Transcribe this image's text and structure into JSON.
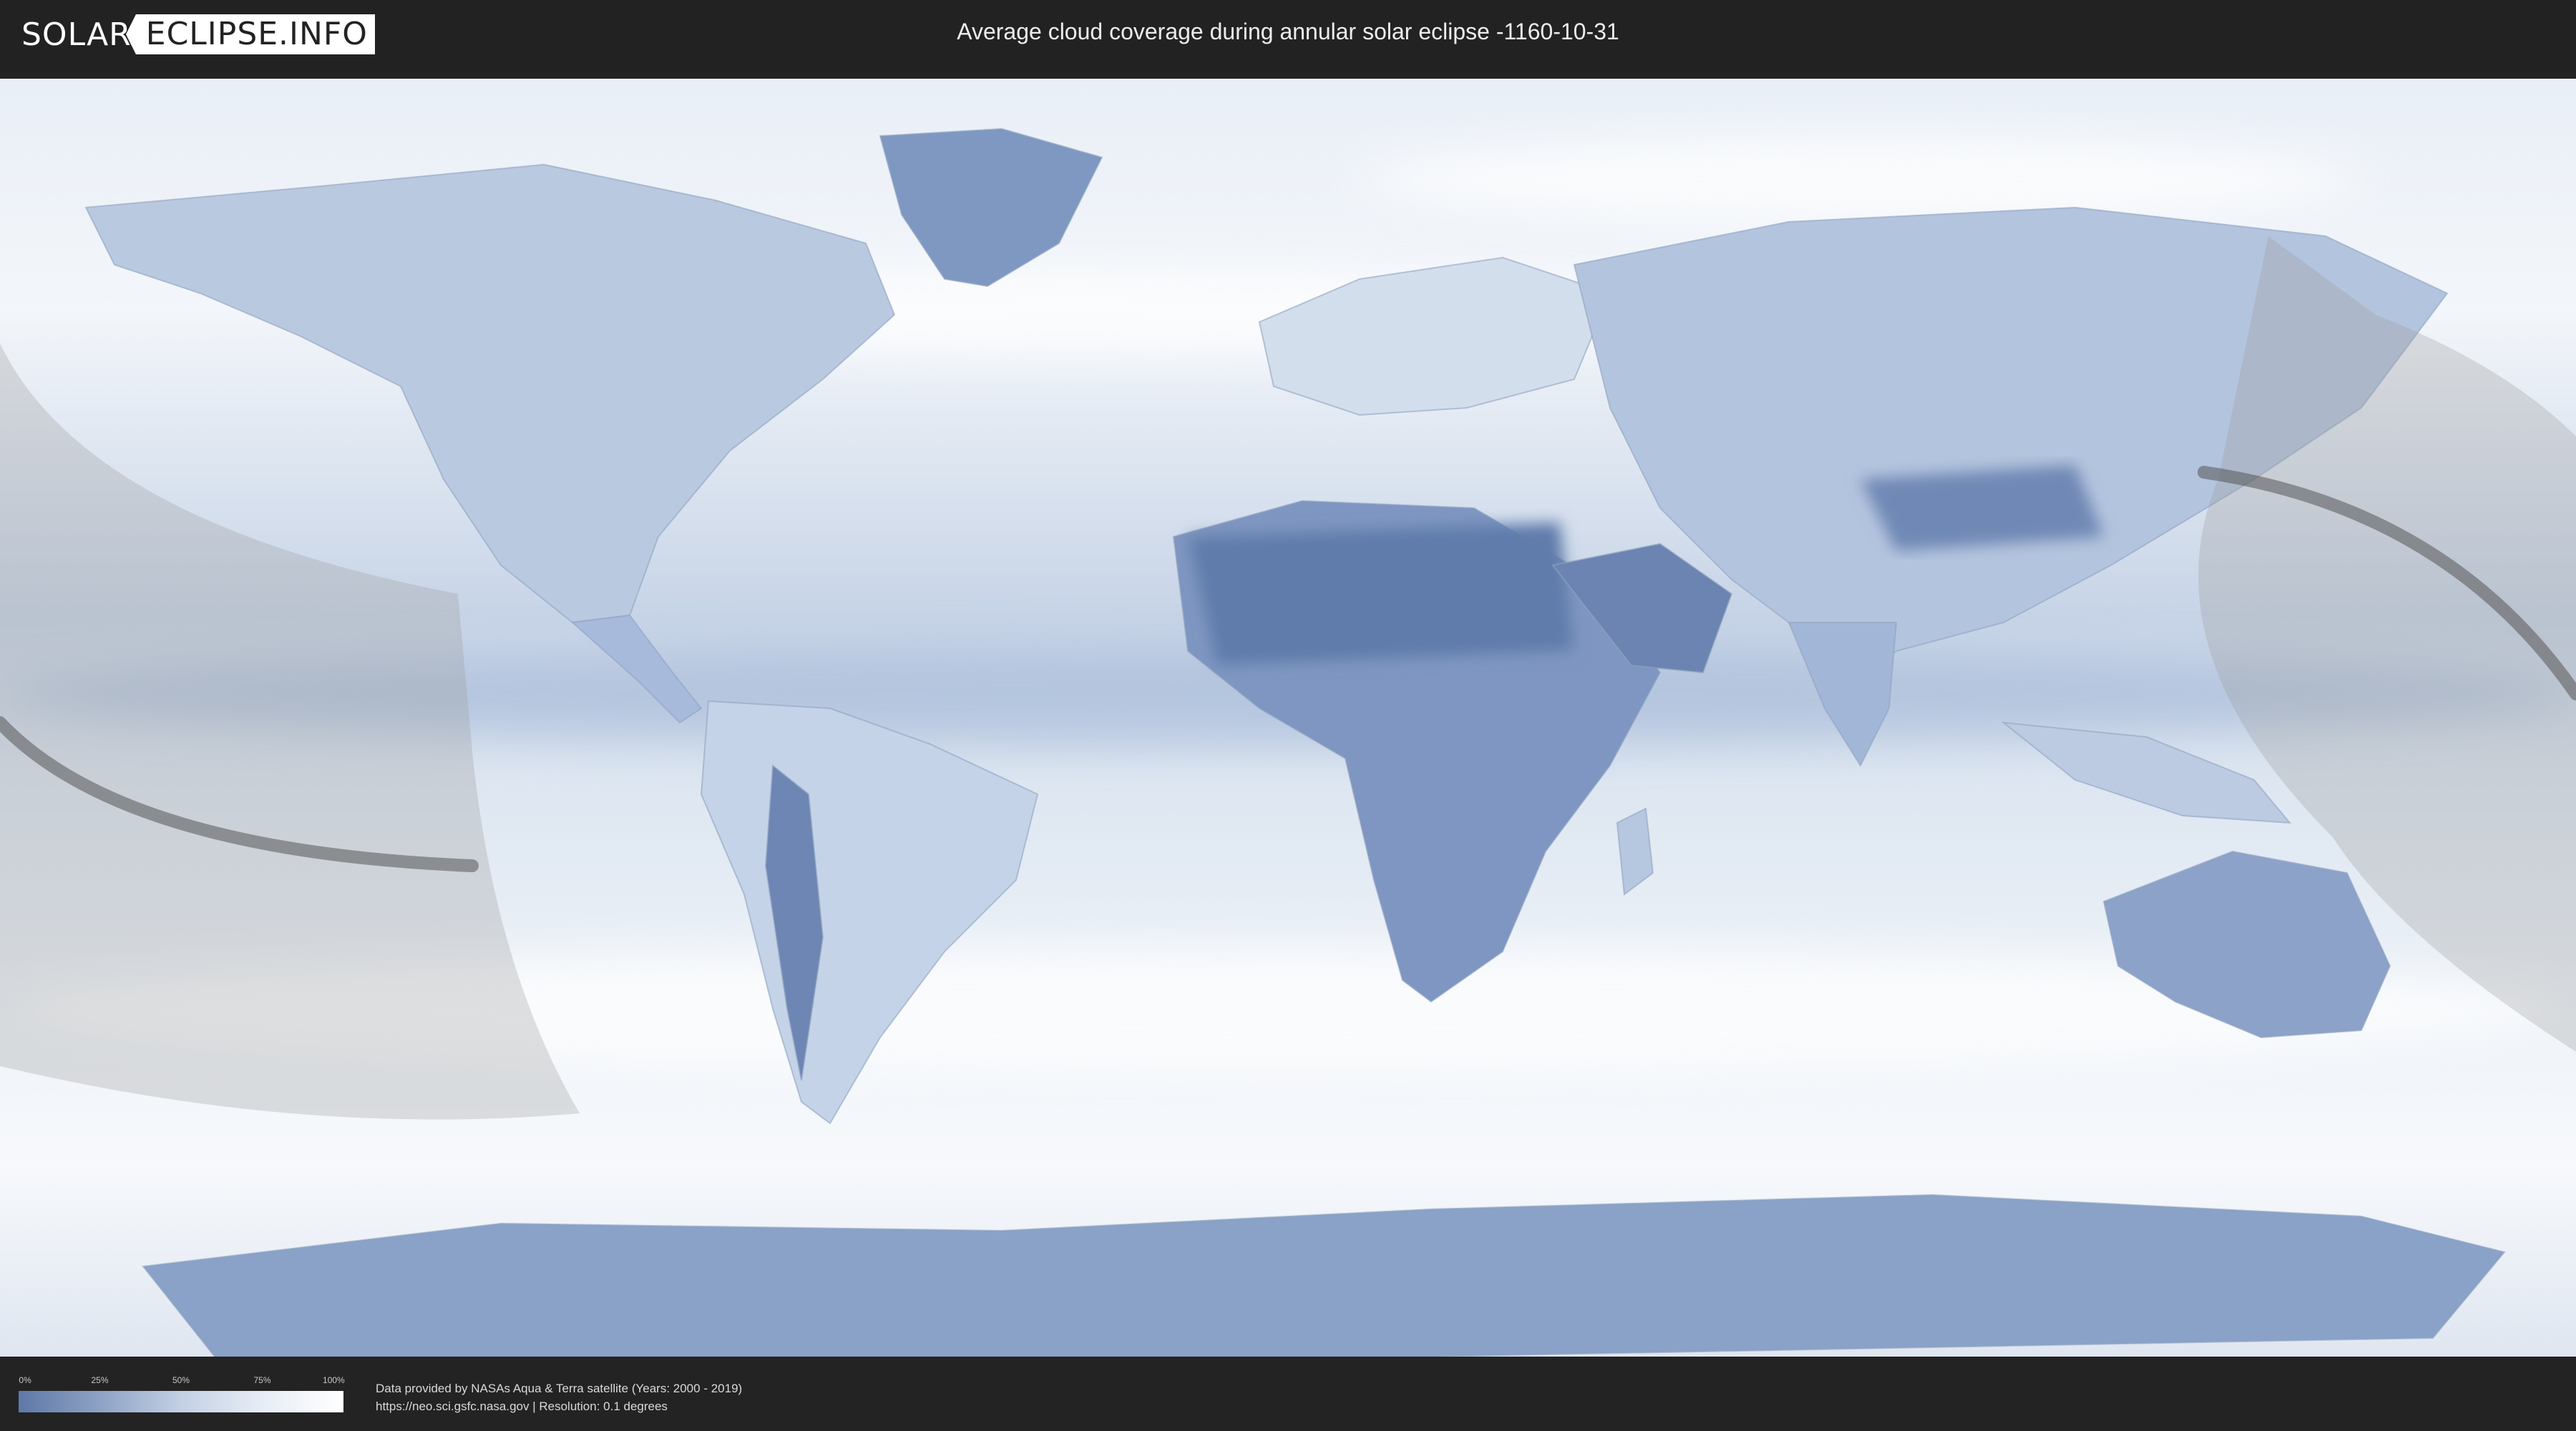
{
  "logo": {
    "part1": "SOLAR",
    "part2": "ECLIPSE.INFO"
  },
  "header": {
    "title": "Average cloud coverage during annular solar eclipse -1160-10-31"
  },
  "legend": {
    "ticks": [
      "0%",
      "25%",
      "50%",
      "75%",
      "100%"
    ]
  },
  "credits": {
    "line1": "Data provided by NASAs Aqua & Terra satellite (Years: 2000 - 2019)",
    "line2": "https://neo.sci.gsfc.nasa.gov | Resolution: 0.1 degrees"
  },
  "colors": {
    "cloud_low": "#5f78a6",
    "cloud_high": "#ffffff",
    "eclipse_shadow": "#9a9a9a",
    "central_line": "#555555"
  }
}
